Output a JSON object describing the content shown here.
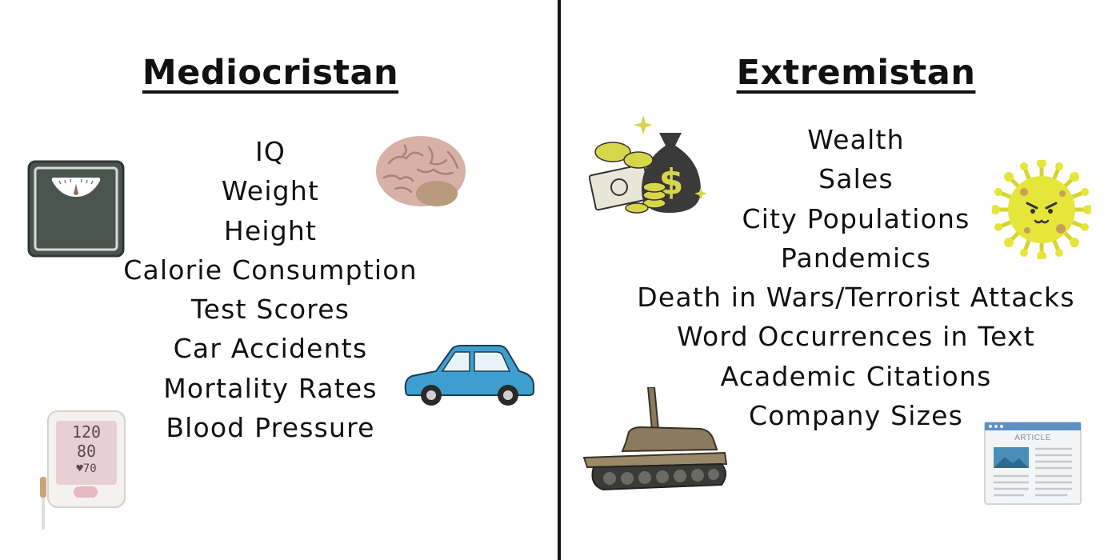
{
  "mediocristan": {
    "title": "Mediocristan",
    "items": [
      "IQ",
      "Weight",
      "Height",
      "Calorie Consumption",
      "Test Scores",
      "Car Accidents",
      "Mortality Rates",
      "Blood Pressure"
    ],
    "icons": [
      "scale-icon",
      "brain-icon",
      "car-icon",
      "blood-pressure-monitor-icon"
    ],
    "monitor_display": [
      "120",
      "80",
      "♥70"
    ]
  },
  "extremistan": {
    "title": "Extremistan",
    "items": [
      "Wealth",
      "Sales",
      "City Populations",
      "Pandemics",
      "Death in Wars/Terrorist Attacks",
      "Word Occurrences in Text",
      "Academic Citations",
      "Company Sizes"
    ],
    "icons": [
      "money-bag-icon",
      "virus-icon",
      "tank-icon",
      "article-icon"
    ],
    "article_label": "ARTICLE"
  },
  "colors": {
    "text": "#111111",
    "divider": "#111111",
    "scale": "#4a5550",
    "brain": "#d8b1a6",
    "car": "#3e9fcf",
    "money": "#d6d64a",
    "virus": "#e6e63a",
    "tank": "#8c7a5e"
  }
}
